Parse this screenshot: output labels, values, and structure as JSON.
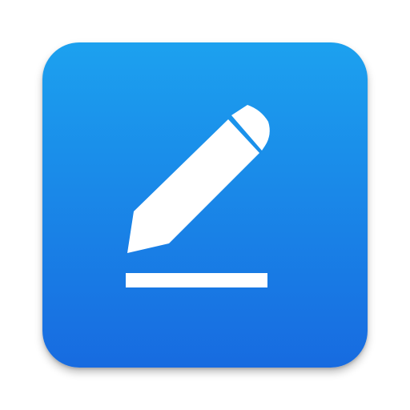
{
  "app_icon": {
    "name": "edit-note-app-icon",
    "glyph": "pencil-icon",
    "colors": {
      "gradient_top": "#1ca1ef",
      "gradient_bottom": "#176be0",
      "glyph": "#ffffff"
    }
  }
}
